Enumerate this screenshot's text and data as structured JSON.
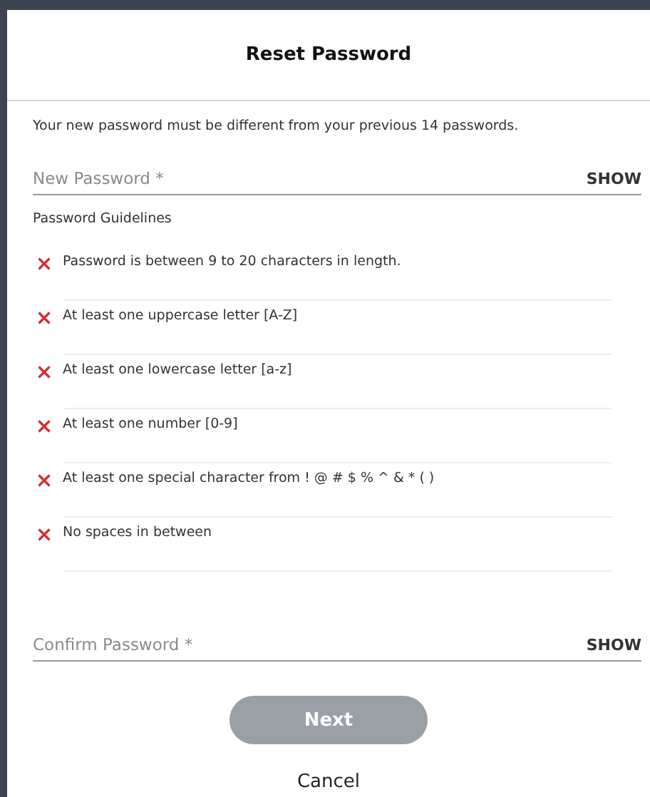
{
  "dialog": {
    "title": "Reset Password"
  },
  "message": "Your new password must be different from your previous 14 passwords.",
  "new_password": {
    "placeholder": "New Password *",
    "toggle": "SHOW"
  },
  "guidelines": {
    "heading": "Password Guidelines",
    "rules": [
      {
        "text": "Password is between 9 to 20 characters in length.",
        "met": false
      },
      {
        "text": "At least one uppercase letter [A-Z]",
        "met": false
      },
      {
        "text": "At least one lowercase letter [a-z]",
        "met": false
      },
      {
        "text": "At least one number [0-9]",
        "met": false
      },
      {
        "text": "At least one special character from ! @ # $ % ^ & * ( )",
        "met": false
      },
      {
        "text": "No spaces in between",
        "met": false
      }
    ]
  },
  "confirm_password": {
    "placeholder": "Confirm Password *",
    "toggle": "SHOW"
  },
  "next_button": {
    "label": "Next",
    "disabled": true
  },
  "cancel_link": "Cancel"
}
